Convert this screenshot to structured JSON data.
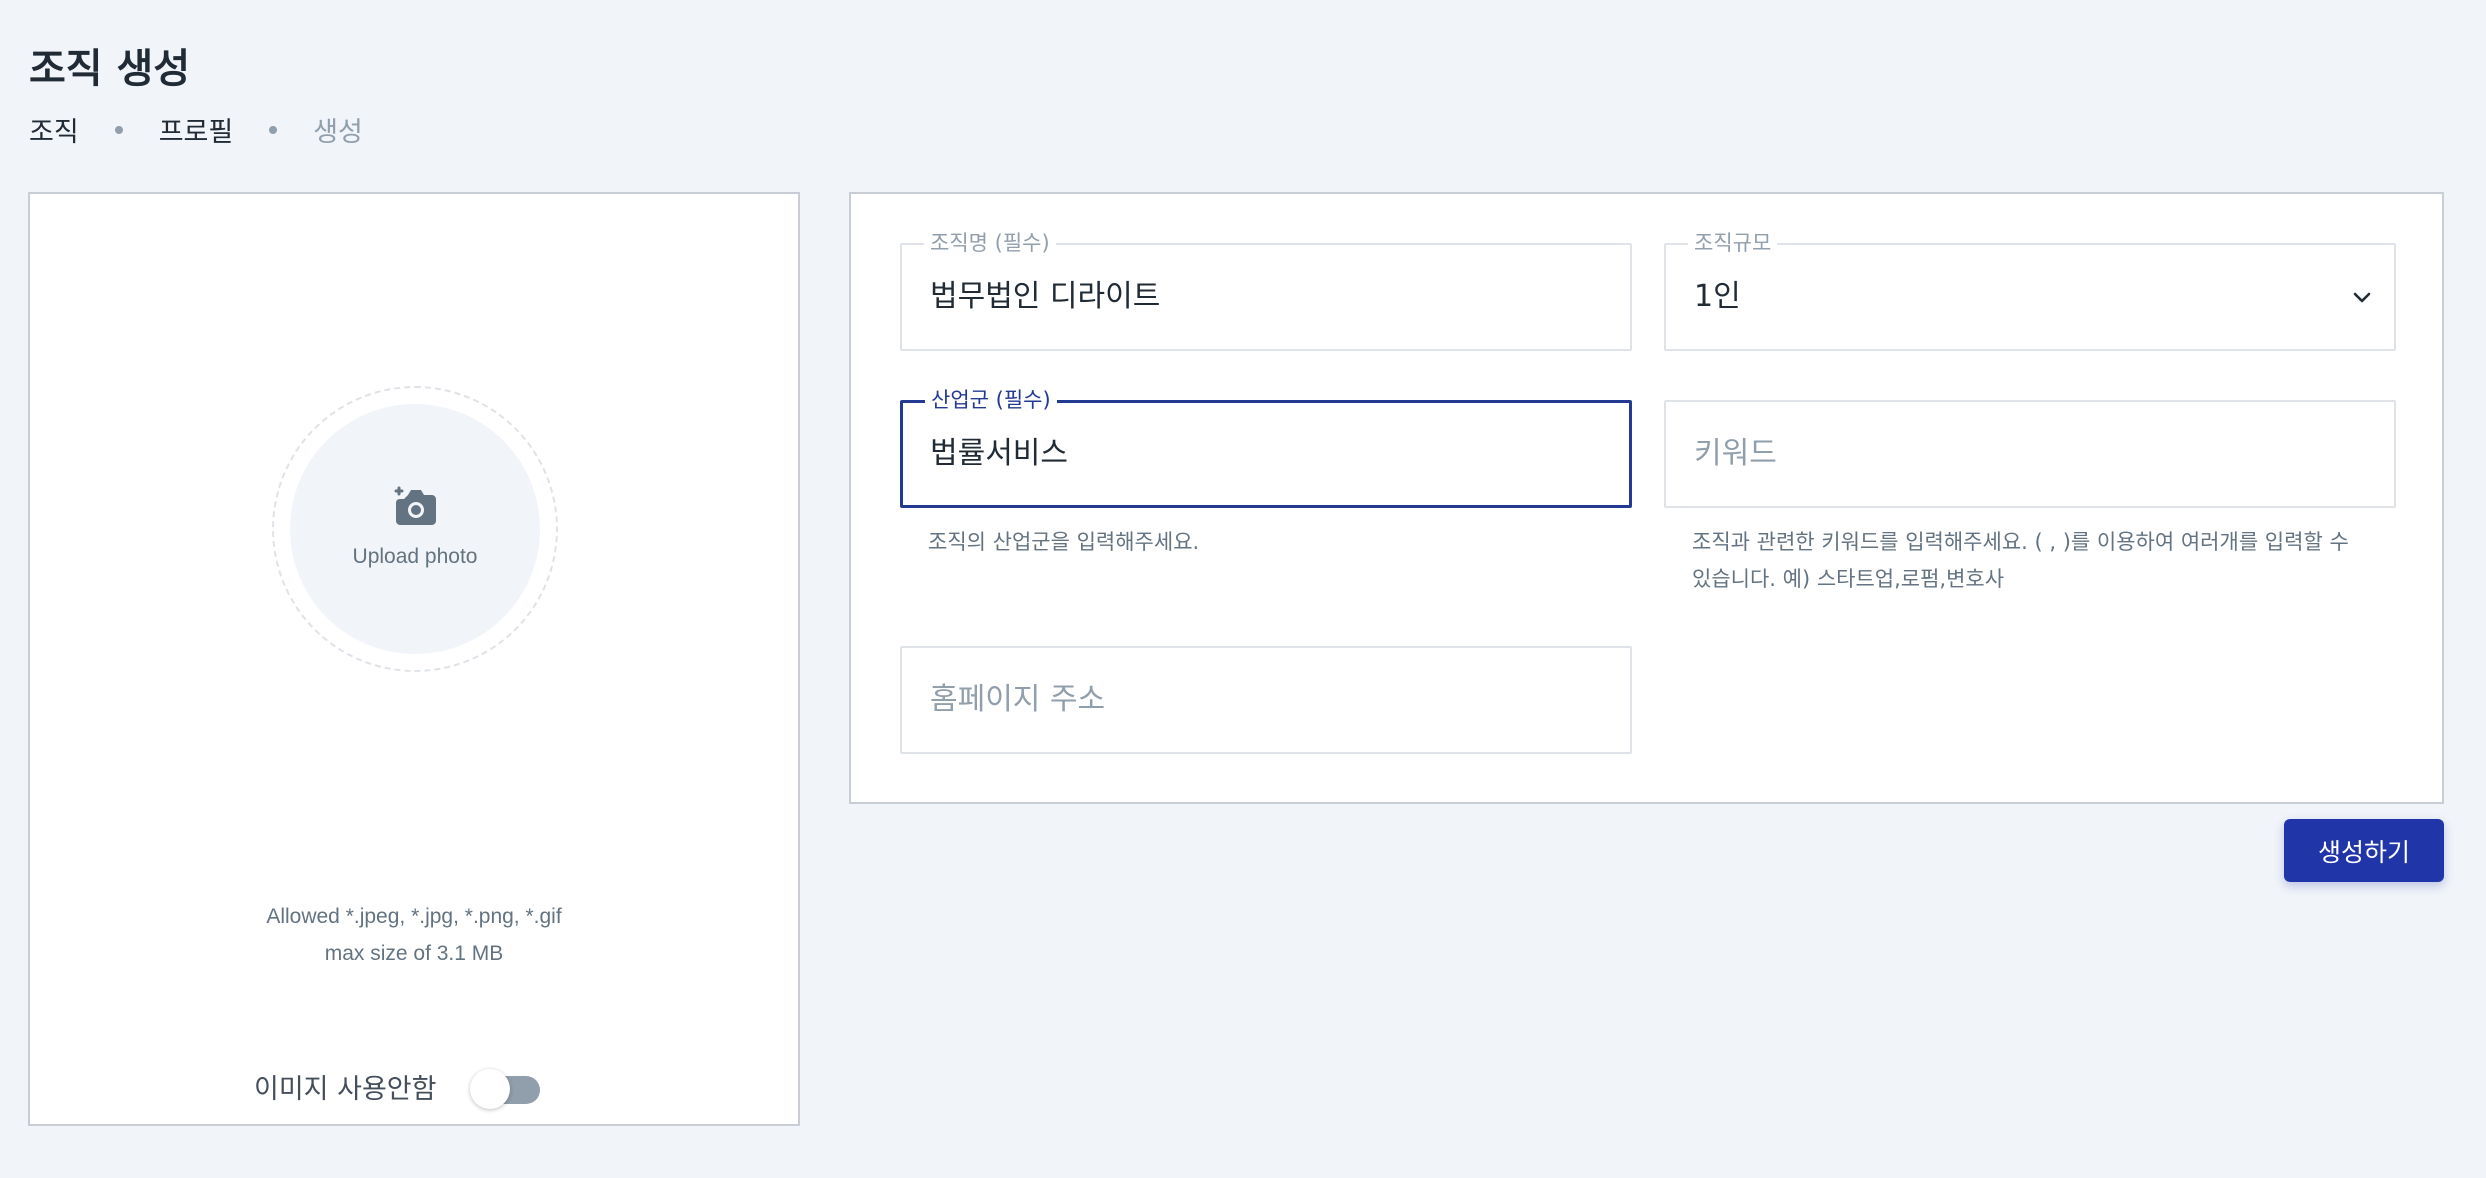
{
  "page": {
    "title": "조직 생성"
  },
  "breadcrumb": {
    "items": [
      "조직",
      "프로필",
      "생성"
    ]
  },
  "photo": {
    "upload_label": "Upload photo",
    "allowed_line1": "Allowed *.jpeg, *.jpg, *.png, *.gif",
    "allowed_line2": "max size of 3.1 MB",
    "toggle_label": "이미지 사용안함",
    "toggle_on": false
  },
  "form": {
    "org_name": {
      "label": "조직명 (필수)",
      "value": "법무법인 디라이트"
    },
    "org_size": {
      "label": "조직규모",
      "value": "1인"
    },
    "industry": {
      "label": "산업군 (필수)",
      "value": "법률서비스",
      "helper": "조직의 산업군을 입력해주세요."
    },
    "keyword": {
      "placeholder": "키워드",
      "helper_line1": "조직과 관련한 키워드를 입력해주세요. ( , )를 이용하여 여러개를 입력할 수",
      "helper_line2": "있습니다. 예) 스타트업,로펌,변호사"
    },
    "homepage": {
      "placeholder": "홈페이지 주소"
    }
  },
  "actions": {
    "create_label": "생성하기"
  },
  "colors": {
    "accent": "#1f35a8",
    "focus_border": "#233a93",
    "background": "#f1f4f9"
  }
}
